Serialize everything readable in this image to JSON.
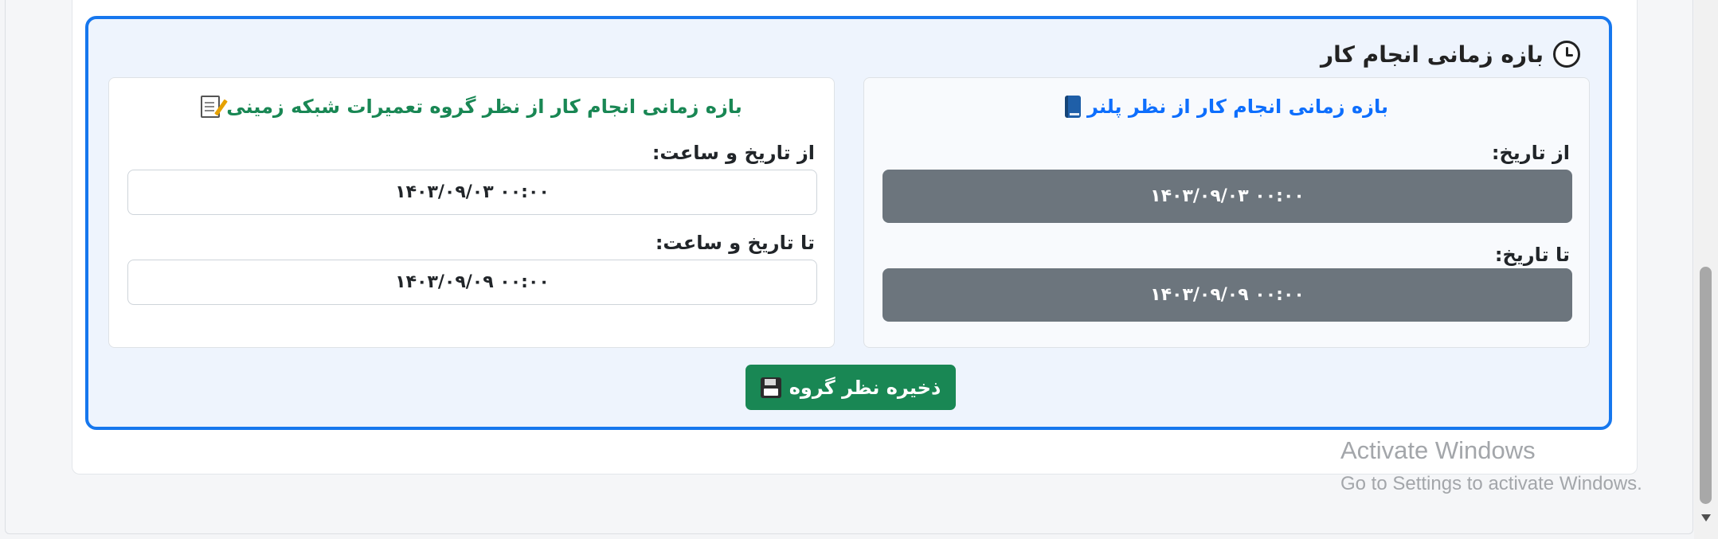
{
  "section": {
    "title": "بازه زمانی انجام کار",
    "icon": "clock-icon"
  },
  "planner_panel": {
    "title": "بازه زمانی انجام کار از نظر پلنر",
    "icon": "book-icon",
    "from_label": "از تاریخ:",
    "from_value": "۱۴۰۳/۰۹/۰۳ ۰۰:۰۰",
    "to_label": "تا تاریخ:",
    "to_value": "۱۴۰۳/۰۹/۰۹ ۰۰:۰۰"
  },
  "repair_panel": {
    "title": "بازه زمانی انجام کار از نظر گروه تعمیرات شبکه زمینی",
    "icon": "memo-icon",
    "from_label": "از تاریخ و ساعت:",
    "from_value": "۱۴۰۳/۰۹/۰۳ ۰۰:۰۰",
    "to_label": "تا تاریخ و ساعت:",
    "to_value": "۱۴۰۳/۰۹/۰۹ ۰۰:۰۰"
  },
  "save_button": {
    "label": "ذخیره نظر گروه",
    "icon": "floppy-disk-icon"
  },
  "watermark": {
    "title": "Activate Windows",
    "subtitle": "Go to Settings to activate Windows."
  },
  "colors": {
    "section_border": "#1677ee",
    "planner_title": "#0d6efd",
    "repair_title": "#198754",
    "readonly_field": "#6c757d",
    "save_button": "#198754"
  }
}
